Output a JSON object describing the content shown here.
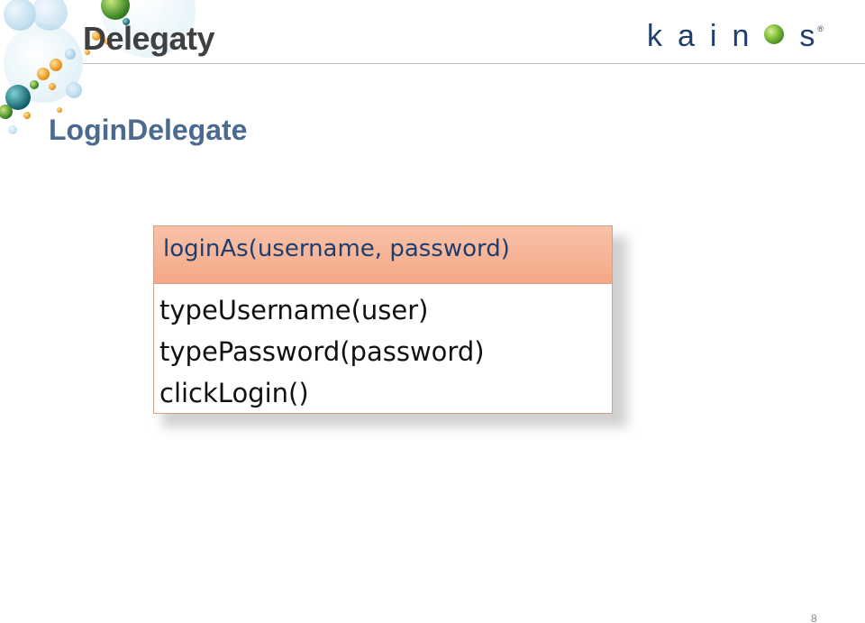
{
  "slide": {
    "title": "Delegaty",
    "subtitle": "LoginDelegate",
    "page_number": "8"
  },
  "logo": {
    "text_left": "kain",
    "text_right": "s",
    "registered": "®",
    "icon": "green-sphere-icon"
  },
  "uml": {
    "header": "loginAs(username, password)",
    "methods": [
      "typeUsername(user)",
      "typePassword(password)",
      "clickLogin()"
    ]
  },
  "colors": {
    "title": "#404040",
    "subtitle": "#4a6a8f",
    "logo": "#1f3e6e",
    "header_fill": "#f4a887"
  }
}
